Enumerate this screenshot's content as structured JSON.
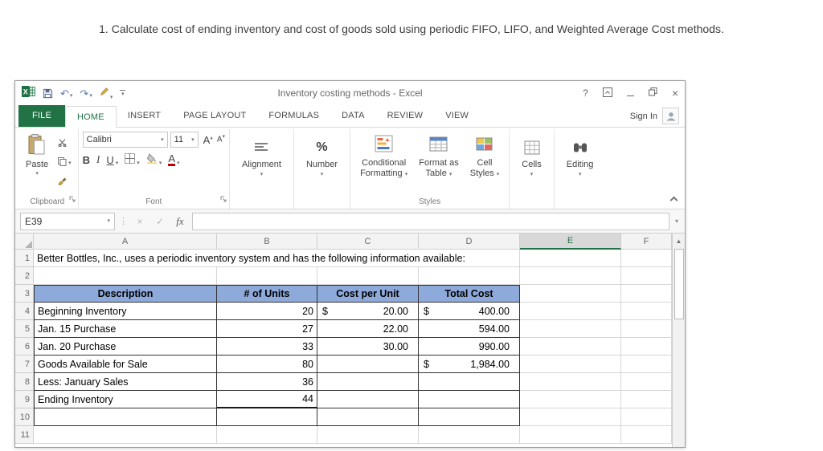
{
  "page": {
    "instruction": "1. Calculate cost of ending inventory and cost of goods sold using periodic FIFO, LIFO, and Weighted Average Cost methods."
  },
  "titlebar": {
    "title": "Inventory costing methods - Excel"
  },
  "icons": {
    "caret": "▾",
    "up_arrow": "▲",
    "undo": "↶",
    "redo": "↷",
    "check": "✓",
    "cancel": "×",
    "close": "×",
    "help": "?",
    "dots": "⋮"
  },
  "tabs": {
    "items": [
      "FILE",
      "HOME",
      "INSERT",
      "PAGE LAYOUT",
      "FORMULAS",
      "DATA",
      "REVIEW",
      "VIEW"
    ],
    "active": "HOME",
    "sign_in": "Sign In"
  },
  "ribbon": {
    "paste": "Paste",
    "clipboard_label": "Clipboard",
    "font_name": "Calibri",
    "font_size": "11",
    "bold": "B",
    "italic": "I",
    "underline": "U",
    "font_label": "Font",
    "alignment_label": "Alignment",
    "percent": "%",
    "number_label": "Number",
    "cond_l1": "Conditional",
    "cond_l2": "Formatting",
    "fmt_l1": "Format as",
    "fmt_l2": "Table",
    "cs_l1": "Cell",
    "cs_l2": "Styles",
    "styles_label": "Styles",
    "cells_label": "Cells",
    "editing_label": "Editing"
  },
  "formula_bar": {
    "name_box": "E39",
    "cancel": "×",
    "enter": "✓",
    "fx": "fx",
    "formula": ""
  },
  "sheet": {
    "col_headers": [
      "A",
      "B",
      "C",
      "D",
      "E",
      "F"
    ],
    "row_headers": [
      "1",
      "2",
      "3",
      "4",
      "5",
      "6",
      "7",
      "8",
      "9",
      "10",
      "11"
    ],
    "selected_column": "E",
    "a1": "Better Bottles, Inc., uses a periodic inventory system and has the following information available:",
    "header": {
      "a": "Description",
      "b": "# of Units",
      "c": "Cost per Unit",
      "d": "Total Cost"
    },
    "rows": [
      {
        "a": "Beginning Inventory",
        "b": "20",
        "c_sym": "$",
        "c": "20.00",
        "d_sym": "$",
        "d": "400.00"
      },
      {
        "a": "Jan. 15 Purchase",
        "b": "27",
        "c_sym": "",
        "c": "22.00",
        "d_sym": "",
        "d": "594.00"
      },
      {
        "a": "Jan. 20 Purchase",
        "b": "33",
        "c_sym": "",
        "c": "30.00",
        "d_sym": "",
        "d": "990.00"
      },
      {
        "a": "Goods Available for Sale",
        "b": "80",
        "c_sym": "",
        "c": "",
        "d_sym": "$",
        "d": "1,984.00"
      },
      {
        "a": "Less: January Sales",
        "b": "36",
        "c_sym": "",
        "c": "",
        "d_sym": "",
        "d": ""
      },
      {
        "a": "Ending Inventory",
        "b": "44",
        "c_sym": "",
        "c": "",
        "d_sym": "",
        "d": ""
      }
    ],
    "colors": {
      "table_header_fill": "#8eaadb",
      "excel_green": "#217346"
    }
  }
}
